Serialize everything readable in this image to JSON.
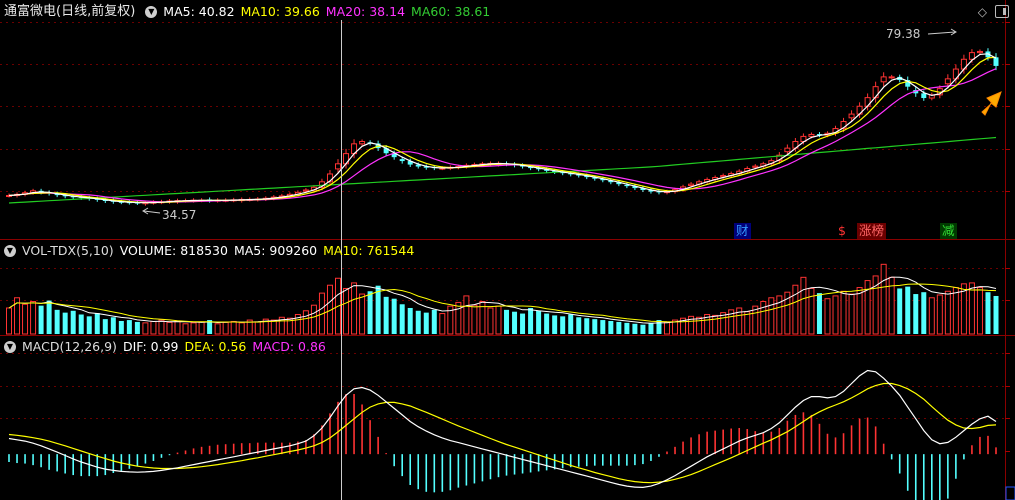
{
  "chart_data": [
    {
      "type": "candlestick",
      "title": "通富微电(日线,前复权)",
      "indicators": [
        {
          "name": "MA5",
          "value": "40.82",
          "color": "#ffffff"
        },
        {
          "name": "MA10",
          "value": "39.66",
          "color": "#ffff00"
        },
        {
          "name": "MA20",
          "value": "38.14",
          "color": "#ff33ff"
        },
        {
          "name": "MA60",
          "value": "38.61",
          "color": "#33cc33"
        }
      ],
      "annotations": {
        "high_label": "79.38",
        "low_label": "34.57"
      },
      "event_tags": [
        {
          "text": "财",
          "color": "#0080ff",
          "bg": "#0000aa"
        },
        {
          "text": "$",
          "color": "#ff3333",
          "bg": ""
        },
        {
          "text": "涨榜",
          "color": "#ff5555",
          "bg": "#7a0000"
        },
        {
          "text": "减",
          "color": "#33cc33",
          "bg": "#004400"
        }
      ],
      "close": [
        36.7,
        37.0,
        37.4,
        37.9,
        37.5,
        37.2,
        36.8,
        36.5,
        36.3,
        36.1,
        35.9,
        35.6,
        35.3,
        35.1,
        35.0,
        34.9,
        34.8,
        34.9,
        35.0,
        35.1,
        35.3,
        35.4,
        35.4,
        35.5,
        35.5,
        35.4,
        35.5,
        35.5,
        35.6,
        35.7,
        35.7,
        35.8,
        36.0,
        36.3,
        36.6,
        37.0,
        37.5,
        38.1,
        38.8,
        40.2,
        42.2,
        44.8,
        47.4,
        49.9,
        50.5,
        50.0,
        48.8,
        47.5,
        46.5,
        45.5,
        44.6,
        44.1,
        43.8,
        43.7,
        43.7,
        43.9,
        44.1,
        44.4,
        44.6,
        44.8,
        44.9,
        44.9,
        44.7,
        44.4,
        44.1,
        43.7,
        43.4,
        43.0,
        42.7,
        42.4,
        42.1,
        41.8,
        41.4,
        41.0,
        40.6,
        40.1,
        39.6,
        39.1,
        38.6,
        38.1,
        37.7,
        37.5,
        37.7,
        38.2,
        38.9,
        39.6,
        40.2,
        40.8,
        41.3,
        41.8,
        42.3,
        42.9,
        43.6,
        44.2,
        44.8,
        45.6,
        47.0,
        48.8,
        50.5,
        51.8,
        52.3,
        52.1,
        52.6,
        53.8,
        55.6,
        57.5,
        59.5,
        61.7,
        64.5,
        67.0,
        67.0,
        66.2,
        64.5,
        62.8,
        61.6,
        62.4,
        64.0,
        66.5,
        69.0,
        71.5,
        73.2,
        73.5,
        72.0,
        69.8
      ],
      "volume_header": {
        "label": "VOL-TDX(5,10)",
        "volume": "VOLUME: 818530",
        "ma5": "MA5: 909260",
        "ma10": "MA10: 761544",
        "colors": {
          "volume": "#ffffff",
          "ma5": "#ffffff",
          "ma10": "#ffff00"
        }
      },
      "volume": [
        560000,
        780000,
        640000,
        700000,
        610000,
        720000,
        520000,
        460000,
        500000,
        420000,
        380000,
        450000,
        320000,
        360000,
        280000,
        300000,
        260000,
        240000,
        270000,
        300000,
        250000,
        280000,
        220000,
        240000,
        260000,
        300000,
        220000,
        250000,
        270000,
        240000,
        300000,
        260000,
        320000,
        300000,
        360000,
        340000,
        420000,
        500000,
        620000,
        880000,
        1050000,
        1200000,
        980000,
        1100000,
        860000,
        920000,
        1040000,
        800000,
        760000,
        640000,
        560000,
        500000,
        460000,
        520000,
        440000,
        600000,
        680000,
        820000,
        620000,
        700000,
        560000,
        600000,
        520000,
        480000,
        440000,
        560000,
        500000,
        440000,
        400000,
        380000,
        420000,
        360000,
        340000,
        320000,
        300000,
        280000,
        260000,
        240000,
        220000,
        200000,
        240000,
        300000,
        260000,
        300000,
        340000,
        380000,
        360000,
        420000,
        400000,
        460000,
        520000,
        560000,
        480000,
        600000,
        700000,
        780000,
        820000,
        900000,
        1050000,
        1220000,
        980000,
        880000,
        760000,
        820000,
        920000,
        860000,
        1000000,
        1150000,
        1250000,
        1500000,
        1220000,
        980000,
        1020000,
        860000,
        900000,
        780000,
        840000,
        920000,
        1000000,
        1080000,
        1100000,
        1000000,
        900000,
        818530
      ],
      "macd_header": {
        "label": "MACD(12,26,9)",
        "dif": "DIF: 0.99",
        "dea": "DEA: 0.56",
        "macd": "MACD: 0.86",
        "colors": {
          "dif": "#ffffff",
          "dea": "#ffff00",
          "macd": "#ff33ff"
        }
      },
      "dif": [
        0.6,
        0.55,
        0.5,
        0.42,
        0.32,
        0.2,
        0.08,
        -0.05,
        -0.18,
        -0.3,
        -0.4,
        -0.5,
        -0.57,
        -0.62,
        -0.66,
        -0.68,
        -0.69,
        -0.68,
        -0.66,
        -0.62,
        -0.57,
        -0.52,
        -0.46,
        -0.4,
        -0.34,
        -0.28,
        -0.22,
        -0.16,
        -0.1,
        -0.04,
        0.02,
        0.08,
        0.14,
        0.2,
        0.26,
        0.32,
        0.4,
        0.5,
        0.7,
        1.0,
        1.4,
        1.85,
        2.25,
        2.5,
        2.55,
        2.45,
        2.25,
        2.0,
        1.75,
        1.5,
        1.25,
        1.05,
        0.88,
        0.74,
        0.62,
        0.52,
        0.44,
        0.36,
        0.28,
        0.2,
        0.12,
        0.04,
        -0.04,
        -0.12,
        -0.2,
        -0.28,
        -0.36,
        -0.44,
        -0.52,
        -0.6,
        -0.68,
        -0.76,
        -0.84,
        -0.92,
        -1.0,
        -1.08,
        -1.16,
        -1.22,
        -1.26,
        -1.27,
        -1.22,
        -1.12,
        -0.98,
        -0.82,
        -0.64,
        -0.46,
        -0.28,
        -0.1,
        0.05,
        0.2,
        0.35,
        0.5,
        0.62,
        0.72,
        0.82,
        0.98,
        1.2,
        1.5,
        1.8,
        2.05,
        2.2,
        2.2,
        2.15,
        2.2,
        2.4,
        2.7,
        3.0,
        3.2,
        3.15,
        2.9,
        2.6,
        2.25,
        1.8,
        1.35,
        0.9,
        0.55,
        0.4,
        0.45,
        0.65,
        0.9,
        1.15,
        1.35,
        1.45,
        1.25
      ],
      "dea": [
        0.75,
        0.72,
        0.68,
        0.63,
        0.57,
        0.5,
        0.41,
        0.32,
        0.22,
        0.12,
        0.02,
        -0.08,
        -0.17,
        -0.26,
        -0.34,
        -0.4,
        -0.46,
        -0.5,
        -0.53,
        -0.55,
        -0.55,
        -0.55,
        -0.53,
        -0.51,
        -0.48,
        -0.44,
        -0.4,
        -0.35,
        -0.3,
        -0.25,
        -0.19,
        -0.14,
        -0.08,
        -0.02,
        0.04,
        0.1,
        0.16,
        0.23,
        0.32,
        0.45,
        0.62,
        0.85,
        1.1,
        1.35,
        1.6,
        1.8,
        1.92,
        1.98,
        1.98,
        1.92,
        1.84,
        1.72,
        1.6,
        1.47,
        1.34,
        1.21,
        1.08,
        0.96,
        0.84,
        0.72,
        0.6,
        0.48,
        0.37,
        0.27,
        0.17,
        0.07,
        -0.03,
        -0.13,
        -0.23,
        -0.33,
        -0.43,
        -0.52,
        -0.61,
        -0.7,
        -0.78,
        -0.86,
        -0.94,
        -1.0,
        -1.05,
        -1.08,
        -1.09,
        -1.07,
        -1.03,
        -0.96,
        -0.88,
        -0.78,
        -0.66,
        -0.53,
        -0.4,
        -0.27,
        -0.14,
        0.0,
        0.14,
        0.28,
        0.42,
        0.55,
        0.7,
        0.86,
        1.05,
        1.25,
        1.45,
        1.62,
        1.76,
        1.88,
        2.0,
        2.15,
        2.32,
        2.5,
        2.62,
        2.7,
        2.7,
        2.62,
        2.5,
        2.32,
        2.1,
        1.82,
        1.55,
        1.3,
        1.12,
        1.0,
        0.98,
        1.02,
        1.1,
        1.12
      ],
      "macd_ylim": [
        -1.6,
        3.6
      ]
    }
  ]
}
